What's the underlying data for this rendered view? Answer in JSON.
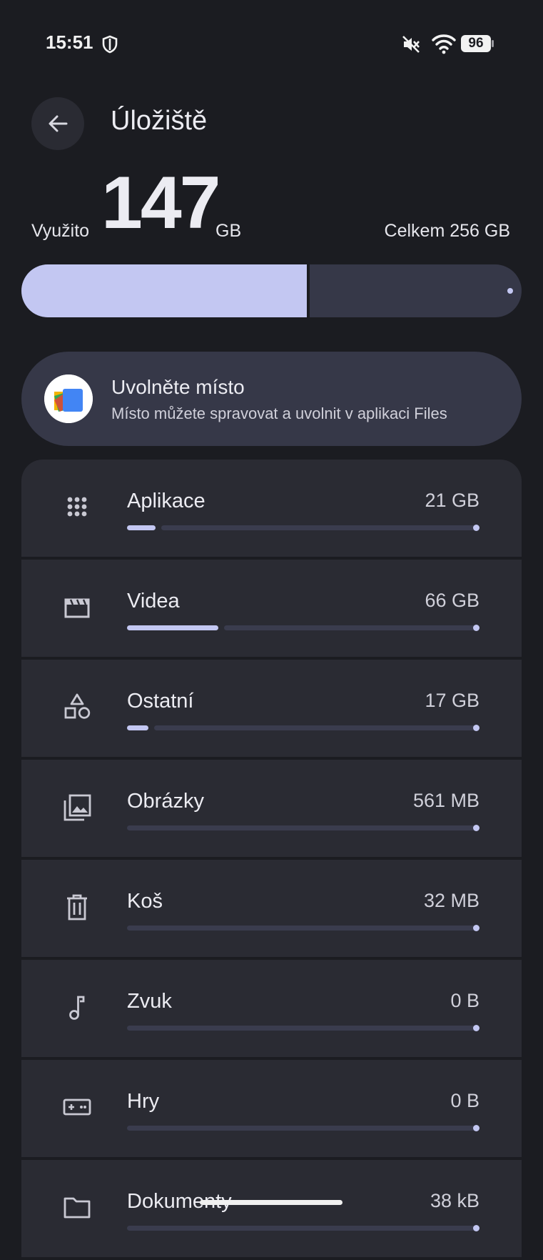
{
  "status_bar": {
    "time": "15:51",
    "battery": "96"
  },
  "header": {
    "title": "Úložiště"
  },
  "usage": {
    "used_label": "Využito",
    "used_value": "147",
    "used_unit": "GB",
    "total_label": "Celkem 256 GB",
    "used_fraction": 0.57
  },
  "free_space": {
    "title": "Uvolněte místo",
    "subtitle": "Místo můžete spravovat a uvolnit v aplikaci Files"
  },
  "categories": [
    {
      "name": "Aplikace",
      "size": "21 GB",
      "icon": "apps-grid-icon",
      "fraction": 0.08
    },
    {
      "name": "Videa",
      "size": "66 GB",
      "icon": "movie-icon",
      "fraction": 0.26
    },
    {
      "name": "Ostatní",
      "size": "17 GB",
      "icon": "shapes-icon",
      "fraction": 0.06
    },
    {
      "name": "Obrázky",
      "size": "561 MB",
      "icon": "images-icon",
      "fraction": 0
    },
    {
      "name": "Koš",
      "size": "32 MB",
      "icon": "trash-icon",
      "fraction": 0
    },
    {
      "name": "Zvuk",
      "size": "0 B",
      "icon": "music-note-icon",
      "fraction": 0
    },
    {
      "name": "Hry",
      "size": "0 B",
      "icon": "gamepad-icon",
      "fraction": 0
    },
    {
      "name": "Dokumenty",
      "size": "38 kB",
      "icon": "folder-icon",
      "fraction": 0
    }
  ],
  "colors": {
    "background": "#1b1c21",
    "accent": "#c3c7f2",
    "card": "#2a2b33",
    "track": "#363848"
  }
}
